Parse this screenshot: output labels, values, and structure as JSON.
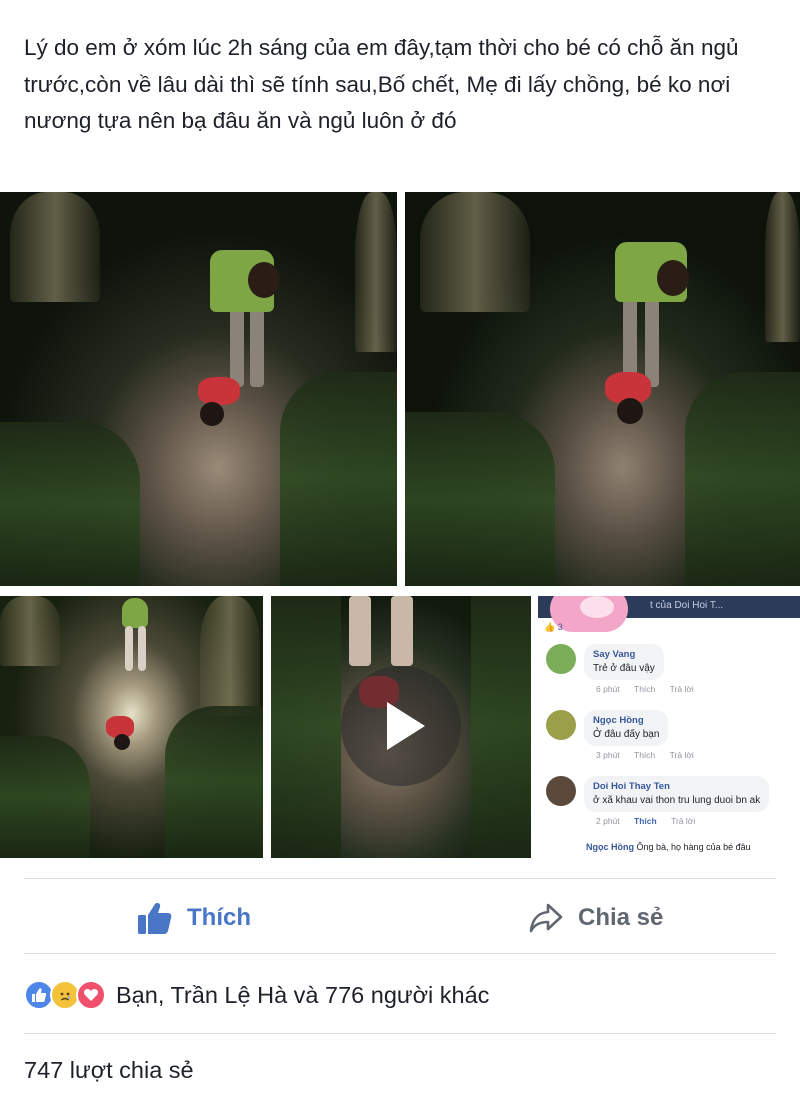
{
  "post": {
    "text": "Lý do em ở xóm lúc 2h sáng của em đây,tạm thời cho bé có chỗ ăn ngủ trước,còn về lâu dài thì sẽ tính sau,Bố chết, Mẹ đi lấy chồng, bé ko nơi nương tựa nên bạ đâu ăn và ngủ luôn ở đó"
  },
  "screenshot": {
    "header_fragment": "t của Doi Hoi T...",
    "reaction_count": "3",
    "comments": [
      {
        "name": "Say Vang",
        "text": "Trẻ ở đâu vậy",
        "time": "6 phút",
        "like": "Thích",
        "reply": "Trả lời"
      },
      {
        "name": "Ngọc Hồng",
        "text": "Ở đâu đấy bạn",
        "time": "3 phút",
        "like": "Thích",
        "reply": "Trả lời"
      },
      {
        "name": "Doi Hoi Thay Ten",
        "text": "ở xã khau vai thon tru lung duoi bn ak",
        "time": "2 phút",
        "like": "Thích",
        "reply": "Trả lời"
      }
    ],
    "more_reply_name": "Ngọc Hồng",
    "more_reply_text": "Ông bà, họ hàng của bé đâu"
  },
  "actions": {
    "like_label": "Thích",
    "share_label": "Chia sẻ"
  },
  "reactions": {
    "summary": "Bạn, Trần Lệ Hà và 776 người khác"
  },
  "shares": {
    "count_text": "747 lượt chia sẻ"
  },
  "colors": {
    "like_blue": "#4a76c8",
    "love_red": "#f0506e",
    "sad_yellow": "#f5c33b"
  }
}
